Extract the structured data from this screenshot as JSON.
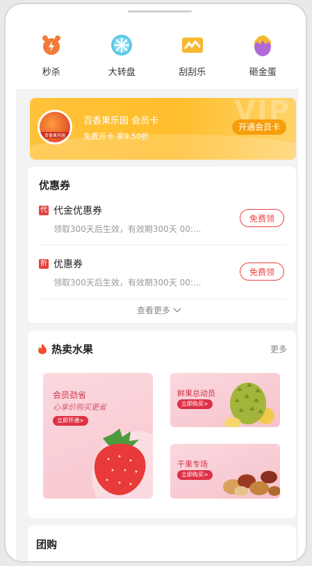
{
  "nav": [
    {
      "label": "秒杀",
      "icon": "alarm-clock-icon",
      "color": "#f07b3a"
    },
    {
      "label": "大转盘",
      "icon": "wheel-icon",
      "color": "#5ec8e6"
    },
    {
      "label": "刮刮乐",
      "icon": "scratch-card-icon",
      "color": "#f6b733"
    },
    {
      "label": "砸金蛋",
      "icon": "golden-egg-icon",
      "color": "#b06ad6"
    }
  ],
  "member": {
    "logo_text": "百香果乐园",
    "title": "百香果乐园 会员卡",
    "subtitle": "免费开卡 享9.50折",
    "button": "开通会员卡",
    "watermark": "VIP"
  },
  "coupons": {
    "title": "优惠券",
    "items": [
      {
        "tag": "代",
        "name": "代金优惠券",
        "desc": "领取300天后生效，有效期300天 00:...",
        "button": "免费领"
      },
      {
        "tag": "折",
        "name": "优惠券",
        "desc": "领取300天后生效，有效期300天 00:...",
        "button": "免费领"
      }
    ],
    "more": "查看更多"
  },
  "hot": {
    "title": "热卖水果",
    "more": "更多",
    "promos": [
      {
        "title": "会员劲省",
        "subtitle": "心享价购买更省",
        "button": "立即开通>"
      },
      {
        "title": "鲜果总动员",
        "button": "立即购买>"
      },
      {
        "title": "干果专场",
        "button": "立即购买>"
      }
    ]
  },
  "group": {
    "title": "团购"
  }
}
